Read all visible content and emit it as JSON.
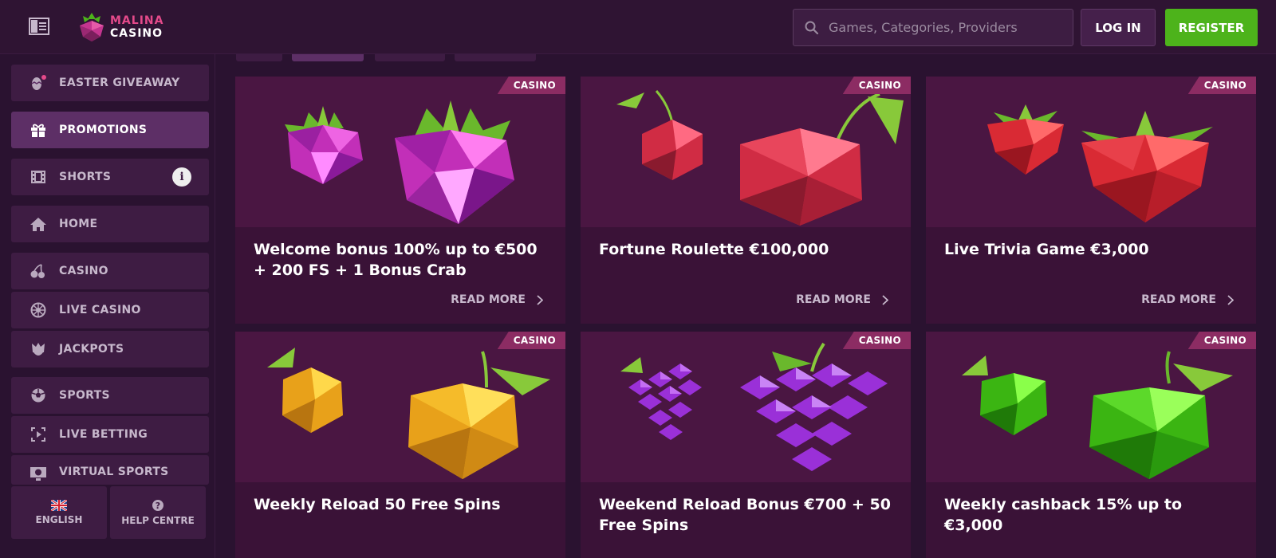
{
  "header": {
    "logo_line1": "MALINA",
    "logo_line2": "CASINO",
    "search_placeholder": "Games, Categories, Providers",
    "login_label": "LOG IN",
    "register_label": "REGISTER"
  },
  "sidebar": {
    "items": [
      {
        "label": "EASTER GIVEAWAY",
        "icon": "easter-egg-icon"
      },
      {
        "label": "PROMOTIONS",
        "icon": "gift-icon",
        "active": true
      },
      {
        "label": "SHORTS",
        "icon": "film-icon",
        "badge": "i"
      },
      {
        "label": "HOME",
        "icon": "home-icon"
      },
      {
        "label": "CASINO",
        "icon": "cherries-icon"
      },
      {
        "label": "LIVE CASINO",
        "icon": "roulette-icon"
      },
      {
        "label": "JACKPOTS",
        "icon": "jackpot-icon"
      },
      {
        "label": "SPORTS",
        "icon": "soccer-ball-icon"
      },
      {
        "label": "LIVE BETTING",
        "icon": "live-betting-icon"
      },
      {
        "label": "VIRTUAL SPORTS",
        "icon": "virtual-sports-icon"
      }
    ],
    "language_label": "ENGLISH",
    "help_label": "HELP CENTRE"
  },
  "promotions": [
    {
      "tag": "CASINO",
      "title": "Welcome bonus 100% up to €500 + 200 FS + 1 Bonus Crab",
      "more": "READ MORE",
      "fruit": "raspberry",
      "color": "#e036c8"
    },
    {
      "tag": "CASINO",
      "title": "Fortune Roulette €100,000",
      "more": "READ MORE",
      "fruit": "cherry",
      "color": "#e43050"
    },
    {
      "tag": "CASINO",
      "title": "Live Trivia Game €3,000",
      "more": "READ MORE",
      "fruit": "strawberry",
      "color": "#e42a3a"
    },
    {
      "tag": "CASINO",
      "title": "Weekly Reload 50 Free Spins",
      "more": "",
      "fruit": "lemon",
      "color": "#f2b21c"
    },
    {
      "tag": "CASINO",
      "title": "Weekend Reload Bonus €700 + 50 Free Spins",
      "more": "",
      "fruit": "grapes",
      "color": "#9a30d8"
    },
    {
      "tag": "CASINO",
      "title": "Weekly cashback 15% up to €3,000",
      "more": "",
      "fruit": "apple",
      "color": "#4ad11a"
    }
  ]
}
